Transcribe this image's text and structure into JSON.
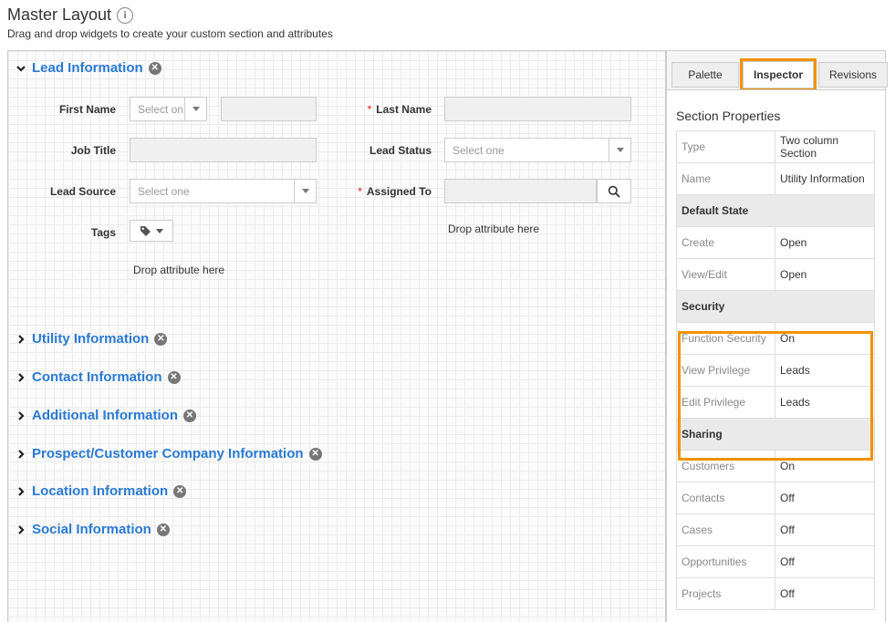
{
  "page": {
    "title": "Master Layout",
    "info_icon": "i",
    "subtitle": "Drag and drop widgets to create your custom section and attributes"
  },
  "lead_section": {
    "title": "Lead Information",
    "fields": {
      "first_name_label": "First Name",
      "first_name_select": "Select on",
      "last_name_label": "Last Name",
      "job_title_label": "Job Title",
      "lead_status_label": "Lead Status",
      "lead_status_select": "Select one",
      "lead_source_label": "Lead Source",
      "lead_source_select": "Select one",
      "assigned_to_label": "Assigned To",
      "tags_label": "Tags",
      "required_mark": "*"
    },
    "drop_left": "Drop attribute here",
    "drop_right": "Drop attribute here"
  },
  "collapsed_sections": [
    {
      "title": "Utility Information"
    },
    {
      "title": "Contact Information"
    },
    {
      "title": "Additional Information"
    },
    {
      "title": "Prospect/Customer Company Information"
    },
    {
      "title": "Location Information"
    },
    {
      "title": "Social Information"
    }
  ],
  "panel": {
    "tabs": [
      {
        "label": "Palette",
        "active": false
      },
      {
        "label": "Inspector",
        "active": true
      },
      {
        "label": "Revisions",
        "active": false
      }
    ],
    "title": "Section Properties",
    "rows": [
      {
        "key": "Type",
        "value": "Two column Section"
      },
      {
        "key": "Name",
        "value": "Utility Information"
      },
      {
        "group": "Default State"
      },
      {
        "key": "Create",
        "value": "Open"
      },
      {
        "key": "View/Edit",
        "value": "Open"
      },
      {
        "group": "Security"
      },
      {
        "key": "Function Security",
        "value": "On"
      },
      {
        "key": "View Privilege",
        "value": "Leads"
      },
      {
        "key": "Edit Privilege",
        "value": "Leads"
      },
      {
        "group": "Sharing"
      },
      {
        "key": "Customers",
        "value": "On"
      },
      {
        "key": "Contacts",
        "value": "Off"
      },
      {
        "key": "Cases",
        "value": "Off"
      },
      {
        "key": "Opportunities",
        "value": "Off"
      },
      {
        "key": "Projects",
        "value": "Off"
      }
    ]
  },
  "colors": {
    "accent": "#2a7ad2",
    "highlight": "#f39200"
  },
  "icons": [
    "info-icon",
    "chevron-down-icon",
    "chevron-right-icon",
    "remove-icon",
    "search-icon",
    "tag-icon"
  ]
}
